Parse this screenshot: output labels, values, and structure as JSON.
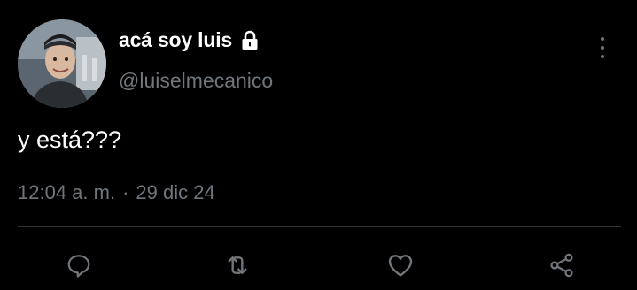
{
  "user": {
    "display_name": "acá soy luis",
    "handle": "@luiselmecanico",
    "protected_icon": "lock-icon"
  },
  "tweet": {
    "text": "y está???",
    "time": "12:04 a. m.",
    "separator": "·",
    "date": "29 dic 24"
  },
  "actions": [
    {
      "name": "reply",
      "icon": "reply-icon"
    },
    {
      "name": "retweet",
      "icon": "retweet-icon"
    },
    {
      "name": "like",
      "icon": "heart-icon"
    },
    {
      "name": "share",
      "icon": "share-icon"
    }
  ],
  "colors": {
    "background": "#000000",
    "primary_text": "#ffffff",
    "secondary_text": "#71767b",
    "divider": "#2f3336"
  }
}
